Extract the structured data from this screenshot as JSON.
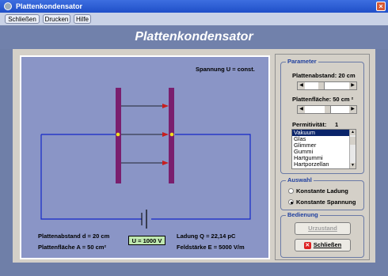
{
  "window": {
    "title": "Plattenkondensator"
  },
  "menu": {
    "items": [
      "Schließen",
      "Drucken",
      "Hilfe"
    ]
  },
  "banner": {
    "title": "Plattenkondensator"
  },
  "sim": {
    "mode_label": "Spannung U = const.",
    "plattenabstand": "Plattenabstand d = 20 cm",
    "plattenflaeche": "Plattenfläche A = 50 cm²",
    "voltage": "U = 1000 V",
    "ladung": "Ladung Q = 22,14 pC",
    "feldstaerke": "Feldstärke E = 5000 V/m"
  },
  "parameter": {
    "group_title": "Parameter",
    "abstand_label": "Plattenabstand: 20 cm",
    "abstand_value": 0.35,
    "flaeche_label": "Plattenfläche: 50 cm ²",
    "flaeche_value": 0.5,
    "permittivitaet_label": "Permitivität:",
    "permittivitaet_value": "1",
    "materials": [
      "Vakuum",
      "Glas",
      "Glimmer",
      "Gummi",
      "Hartgummi",
      "Hartporzellan"
    ],
    "selected_material": "Vakuum"
  },
  "auswahl": {
    "group_title": "Auswahl",
    "options": [
      "Konstante Ladung",
      "Konstante Spannung"
    ],
    "selected": "Konstante Spannung"
  },
  "bedienung": {
    "group_title": "Bedienung",
    "urzustand": "Urzustand",
    "schliessen": "Schließen"
  },
  "colors": {
    "plate": "#7a1f6e",
    "wire": "#1428c8",
    "field_arrow": "#c81e1e",
    "background": "#8a95c6"
  }
}
